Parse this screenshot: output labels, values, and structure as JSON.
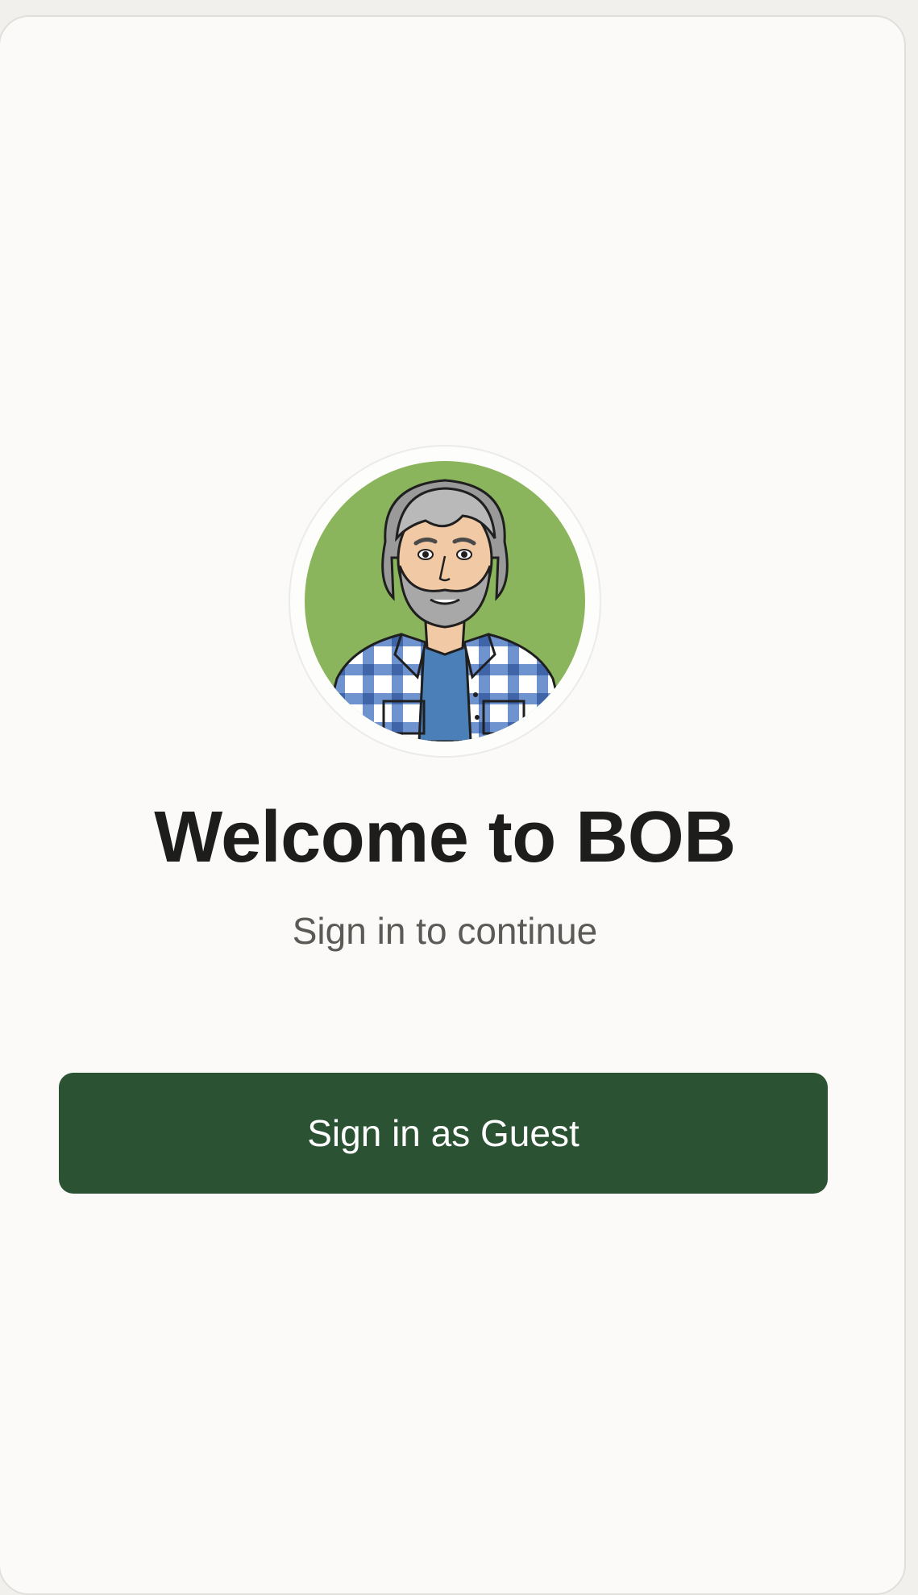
{
  "welcome": {
    "title": "Welcome to BOB",
    "subtitle": "Sign in to continue",
    "guest_button_label": "Sign in as Guest",
    "avatar_icon": "user-avatar-illustration"
  },
  "colors": {
    "button_bg": "#2a5233",
    "avatar_bg": "#8ab55c",
    "title_text": "#1d1d1b",
    "subtitle_text": "#5a5a57",
    "card_bg": "#fbfaf8"
  }
}
